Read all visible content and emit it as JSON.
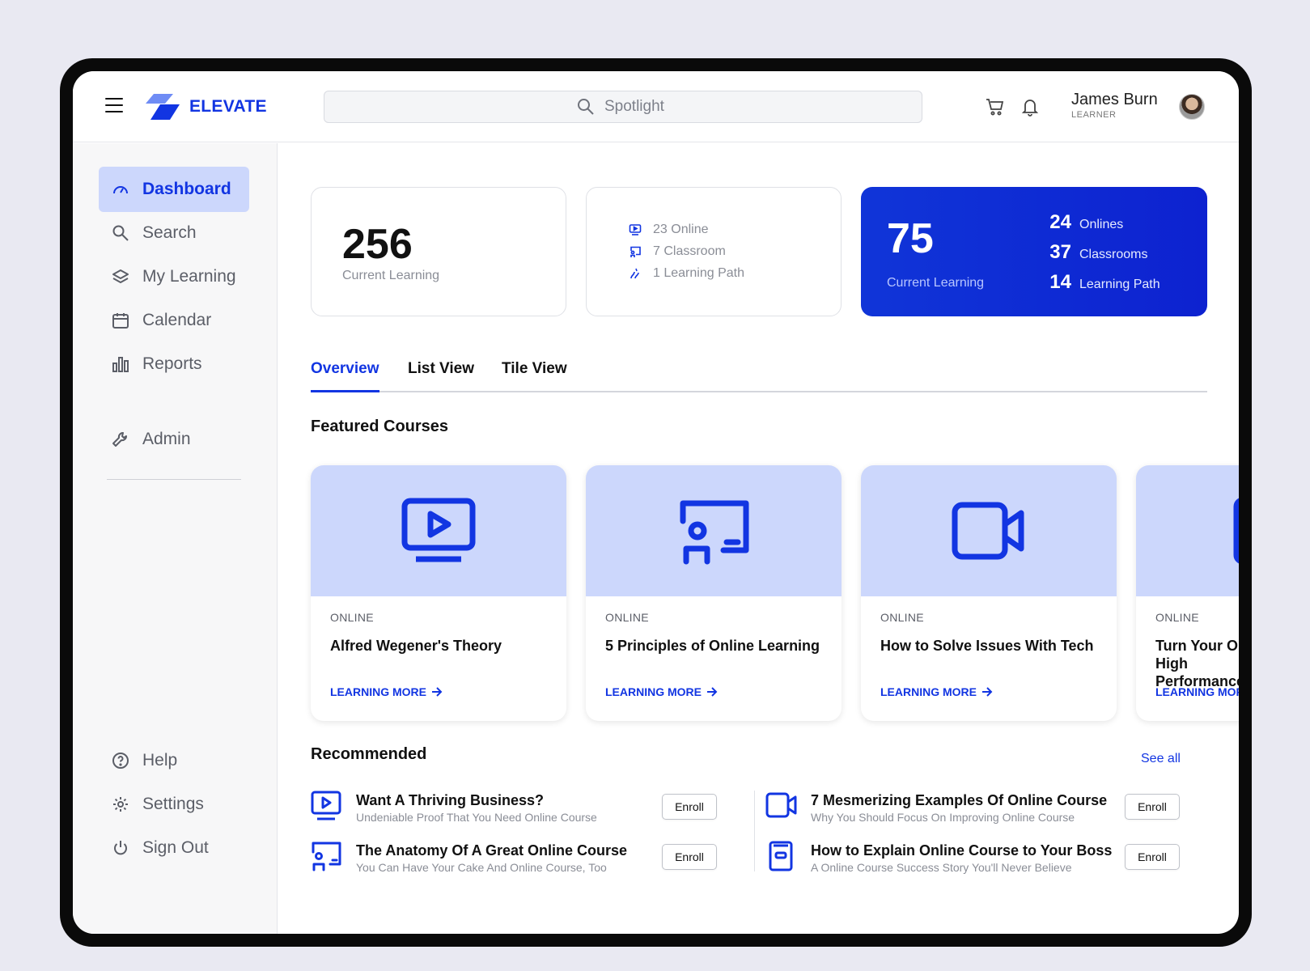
{
  "brand": {
    "name": "ELEVATE",
    "accent": "#1235e2",
    "tint": "#ccd7fc"
  },
  "search": {
    "placeholder": "Spotlight"
  },
  "user": {
    "name": "James Burn",
    "role": "LEARNER"
  },
  "sidebar": {
    "items": [
      {
        "label": "Dashboard",
        "icon": "gauge-icon"
      },
      {
        "label": "Search",
        "icon": "search-icon"
      },
      {
        "label": "My Learning",
        "icon": "layers-icon"
      },
      {
        "label": "Calendar",
        "icon": "calendar-icon"
      },
      {
        "label": "Reports",
        "icon": "bar-chart-icon"
      },
      {
        "label": "Admin",
        "icon": "wrench-icon"
      }
    ],
    "bottom": [
      {
        "label": "Help",
        "icon": "help-icon"
      },
      {
        "label": "Settings",
        "icon": "gear-icon"
      },
      {
        "label": "Sign Out",
        "icon": "power-icon"
      }
    ]
  },
  "stats": {
    "card1": {
      "value": "256",
      "label": "Current Learning"
    },
    "card2": {
      "online": "23 Online",
      "classroom": "7 Classroom",
      "path": "1 Learning Path"
    },
    "card3": {
      "value": "75",
      "label": "Current Learning",
      "rows": [
        {
          "num": "24",
          "label": "Onlines"
        },
        {
          "num": "37",
          "label": "Classrooms"
        },
        {
          "num": "14",
          "label": "Learning Path"
        }
      ]
    }
  },
  "tabs": [
    "Overview",
    "List View",
    "Tile View"
  ],
  "featured": {
    "title": "Featured Courses",
    "courses": [
      {
        "kind": "ONLINE",
        "title": "Alfred Wegener's Theory",
        "cta": "LEARNING MORE",
        "icon": "video-screen-icon"
      },
      {
        "kind": "ONLINE",
        "title": "5 Principles of Online Learning",
        "cta": "LEARNING MORE",
        "icon": "classroom-icon"
      },
      {
        "kind": "ONLINE",
        "title": "How to Solve Issues With Tech",
        "cta": "LEARNING MORE",
        "icon": "video-camera-icon"
      },
      {
        "kind": "ONLINE",
        "title": "Turn Your Online High Performance",
        "cta": "LEARNING MORE",
        "icon": "book-icon"
      }
    ]
  },
  "recommended": {
    "title": "Recommended",
    "see_all": "See all",
    "enroll_label": "Enroll",
    "items": [
      {
        "title": "Want A Thriving Business?",
        "subtitle": "Undeniable Proof That You Need Online Course",
        "icon": "video-screen-icon"
      },
      {
        "title": "The Anatomy Of A Great Online Course",
        "subtitle": "You Can Have Your Cake And Online Course, Too",
        "icon": "classroom-icon"
      },
      {
        "title": "7 Mesmerizing Examples Of Online Course",
        "subtitle": "Why You Should Focus On Improving Online Course",
        "icon": "video-camera-icon"
      },
      {
        "title": "How to Explain Online Course to Your Boss",
        "subtitle": "A Online Course Success Story You'll Never Believe",
        "icon": "book-icon"
      }
    ]
  }
}
